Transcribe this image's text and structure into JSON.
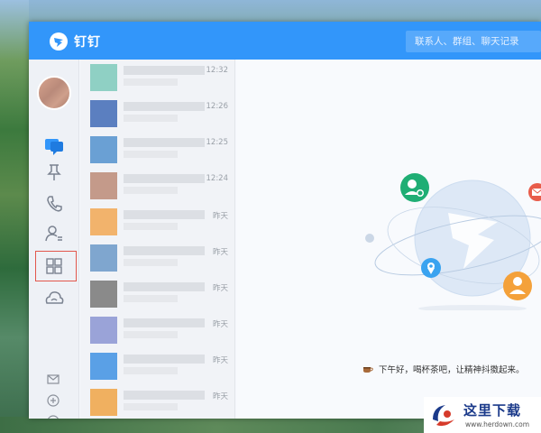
{
  "app": {
    "title": "钉钉"
  },
  "search": {
    "placeholder": "联系人、群组、聊天记录"
  },
  "nav": {
    "items": [
      "message-icon",
      "pin-icon",
      "phone-icon",
      "contacts-icon",
      "workbench-icon",
      "cloud-icon"
    ],
    "bottom": [
      "mail-icon",
      "add-icon",
      "minus-icon"
    ]
  },
  "conversations": [
    {
      "time": "12:32",
      "color": "#8fd0c4"
    },
    {
      "time": "12:26",
      "color": "#5b7fc0"
    },
    {
      "time": "12:25",
      "color": "#6aa0d4"
    },
    {
      "time": "12:24",
      "color": "#c49a8a"
    },
    {
      "time": "昨天",
      "color": "#f2b36c"
    },
    {
      "time": "昨天",
      "color": "#7fa6cf"
    },
    {
      "time": "昨天",
      "color": "#8a8a8a"
    },
    {
      "time": "昨天",
      "color": "#9aa3d8"
    },
    {
      "time": "昨天",
      "color": "#5aa0e6"
    },
    {
      "time": "昨天",
      "color": "#f0b060"
    }
  ],
  "main": {
    "greeting": "下午好，喝杯茶吧，让精神抖擞起来。"
  },
  "watermark": {
    "title": "这里下载",
    "url": "www.herdown.com"
  },
  "colors": {
    "brand": "#3296fa",
    "highlight": "#e2574c"
  }
}
